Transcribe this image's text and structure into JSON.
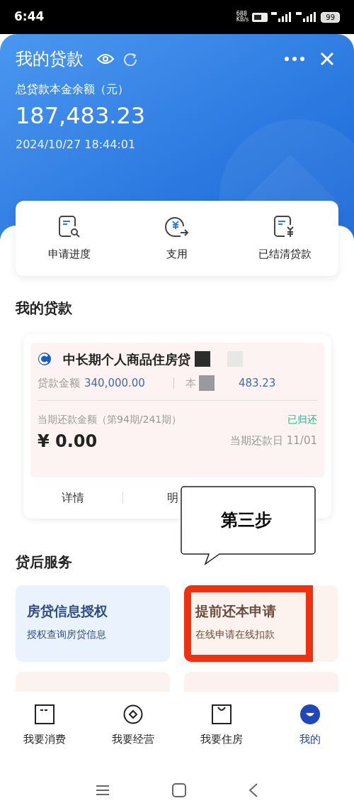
{
  "status_bar": {
    "time": "6:44",
    "speed": "688",
    "speed_unit": "KB/s",
    "battery": "99"
  },
  "header": {
    "title": "我的贷款",
    "balance_label": "总贷款本金余额（元）",
    "balance": "187,483.23",
    "timestamp": "2024/10/27 18:44:01"
  },
  "quick_actions": [
    {
      "kind": "progress",
      "label": "申请进度"
    },
    {
      "kind": "draw",
      "label": "支用"
    },
    {
      "kind": "settled",
      "label": "已结清贷款"
    }
  ],
  "loans_title": "我的贷款",
  "loan": {
    "name": "中长期个人商品住房贷",
    "amount_label": "贷款金额",
    "amount": "340,000.00",
    "principal_label": "本",
    "principal": "483.23",
    "period_label": "当期还款金额（第94期/241期）",
    "status": "已归还",
    "due_amount": "¥ 0.00",
    "due_date": "当期还款日 11/01",
    "actions": [
      "详情",
      "明"
    ]
  },
  "callout": {
    "text": "第三步"
  },
  "services_title": "贷后服务",
  "services": [
    {
      "title": "房贷信息授权",
      "subtitle": "授权查询房贷信息",
      "color": "#2b4a86",
      "highlighted": false
    },
    {
      "title": "提前还本申请",
      "subtitle": "在线申请在线扣款",
      "color": "#6b4a3e",
      "highlighted": true
    }
  ],
  "tabs": [
    {
      "kind": "consume",
      "label": "我要消费",
      "selected": false
    },
    {
      "kind": "business",
      "label": "我要经营",
      "selected": false
    },
    {
      "kind": "housing",
      "label": "我要住房",
      "selected": false
    },
    {
      "kind": "mine",
      "label": "我的",
      "selected": true
    }
  ]
}
